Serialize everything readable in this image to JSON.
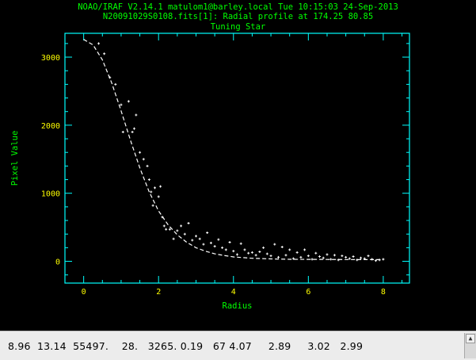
{
  "header": {
    "line1": "NOAO/IRAF V2.14.1 matulom1@barley.local Tue 10:15:03 24-Sep-2013",
    "line2": "N20091029S0108.fits[1]: Radial profile at 174.25 80.85",
    "line3": "Tuning Star"
  },
  "status": {
    "readout": "8.96  13.14  55497.    28.   3265. 0.19   67 4.07     2.89     3.02   2.99"
  },
  "icons": {
    "scroll_up": "up-arrow-icon"
  },
  "colors": {
    "axes": "#00ffff",
    "labels": "#ffff00",
    "titles": "#00ff00",
    "data": "#ffffff"
  },
  "chart_data": {
    "type": "scatter",
    "title": "",
    "xlabel": "Radius",
    "ylabel": "Pixel Value",
    "xlim": [
      -0.5,
      8.7
    ],
    "ylim": [
      -320,
      3350
    ],
    "xticks": [
      0,
      2,
      4,
      6,
      8
    ],
    "yticks": [
      0,
      1000,
      2000,
      3000
    ],
    "grid": false,
    "fit_curve": {
      "style": "dashed",
      "x": [
        0,
        0.25,
        0.5,
        0.75,
        1.0,
        1.25,
        1.5,
        1.75,
        2.0,
        2.25,
        2.5,
        2.75,
        3.0,
        3.25,
        3.5,
        3.75,
        4.0,
        4.5,
        5.0,
        5.5,
        6.0,
        6.5,
        7.0,
        7.5,
        8.0
      ],
      "y": [
        3260,
        3180,
        2960,
        2620,
        2210,
        1780,
        1370,
        1020,
        740,
        540,
        390,
        280,
        200,
        150,
        110,
        85,
        65,
        45,
        35,
        30,
        28,
        27,
        26,
        25,
        25
      ]
    },
    "points": {
      "x": [
        0.4,
        0.55,
        0.7,
        0.85,
        1.0,
        1.05,
        1.2,
        1.3,
        1.35,
        1.4,
        1.5,
        1.6,
        1.7,
        1.75,
        1.8,
        1.85,
        1.9,
        2.0,
        2.05,
        2.1,
        2.15,
        2.2,
        2.3,
        2.4,
        2.5,
        2.6,
        2.7,
        2.8,
        2.9,
        3.0,
        3.1,
        3.2,
        3.3,
        3.4,
        3.5,
        3.6,
        3.7,
        3.8,
        3.9,
        4.0,
        4.1,
        4.2,
        4.3,
        4.4,
        4.5,
        4.6,
        4.7,
        4.8,
        4.9,
        5.0,
        5.1,
        5.2,
        5.3,
        5.4,
        5.5,
        5.6,
        5.7,
        5.8,
        5.9,
        6.0,
        6.1,
        6.2,
        6.3,
        6.4,
        6.5,
        6.6,
        6.7,
        6.8,
        6.9,
        7.0,
        7.1,
        7.2,
        7.3,
        7.4,
        7.5,
        7.6,
        7.7,
        7.8,
        7.9,
        8.0
      ],
      "y": [
        3200,
        3050,
        2700,
        2600,
        2300,
        1900,
        2350,
        1900,
        1950,
        2150,
        1600,
        1500,
        1400,
        1200,
        1020,
        820,
        1080,
        950,
        1100,
        650,
        520,
        470,
        470,
        330,
        450,
        520,
        400,
        560,
        310,
        370,
        330,
        250,
        420,
        270,
        220,
        320,
        200,
        170,
        280,
        150,
        100,
        260,
        170,
        120,
        130,
        90,
        140,
        200,
        110,
        80,
        250,
        60,
        210,
        90,
        170,
        40,
        130,
        60,
        170,
        80,
        30,
        120,
        70,
        50,
        100,
        30,
        90,
        20,
        80,
        60,
        40,
        70,
        20,
        50,
        40,
        80,
        30,
        10,
        20,
        30
      ]
    }
  }
}
